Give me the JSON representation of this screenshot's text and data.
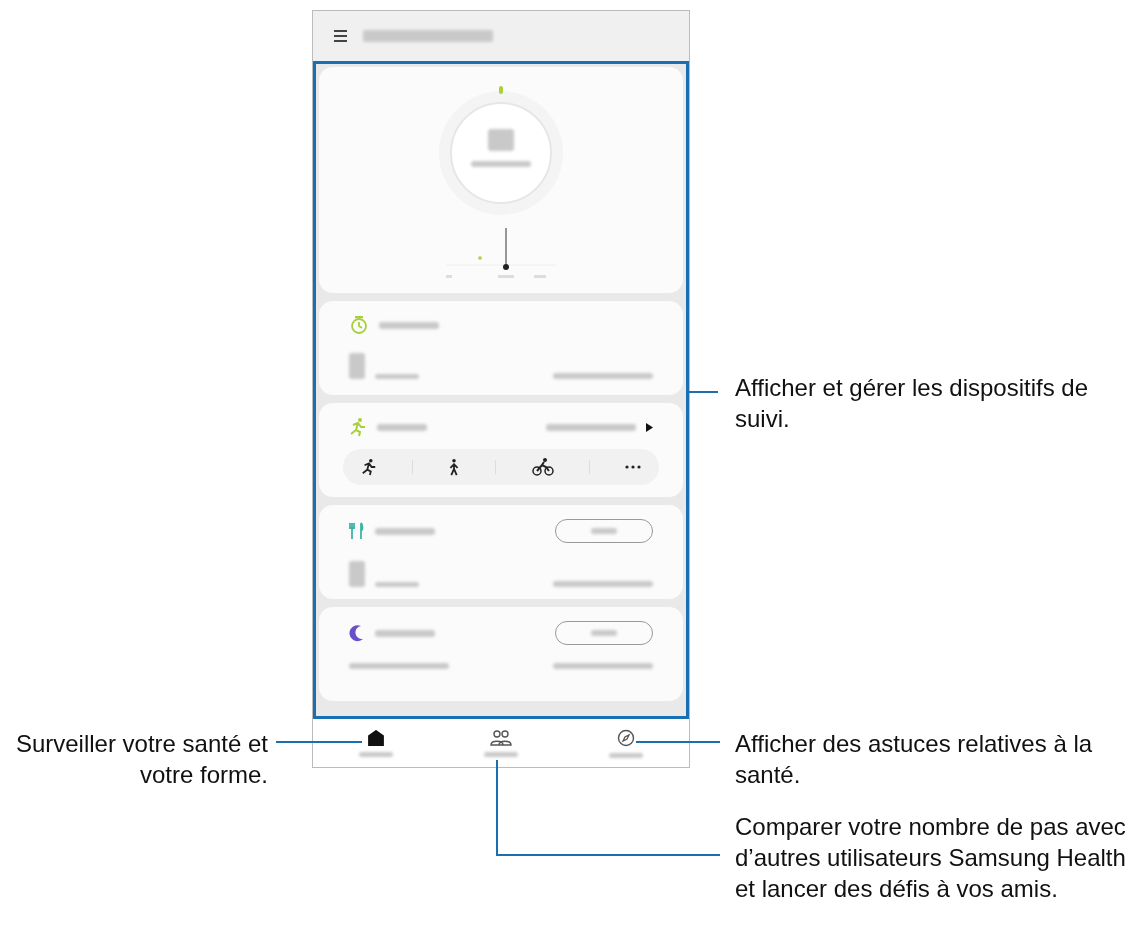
{
  "phone": {
    "cards": [
      {
        "kind": "steps"
      },
      {
        "kind": "timer"
      },
      {
        "kind": "exercise",
        "activities": [
          {
            "kind": "run"
          },
          {
            "kind": "walk"
          },
          {
            "kind": "cycle"
          },
          {
            "kind": "more"
          }
        ]
      },
      {
        "kind": "food"
      },
      {
        "kind": "sleep"
      }
    ],
    "nav": [
      {
        "kind": "home",
        "selected": true
      },
      {
        "kind": "together",
        "selected": false
      },
      {
        "kind": "discover",
        "selected": false
      }
    ]
  },
  "callouts": [
    {
      "text": "Afficher et gérer les dispositifs de suivi."
    },
    {
      "text": "Surveiller votre santé et votre forme."
    },
    {
      "text": "Afficher des astuces relatives à la santé."
    },
    {
      "text": "Comparer votre nombre de pas avec d’autres utilisateurs Samsung Health et lancer des défis à vos amis."
    }
  ]
}
